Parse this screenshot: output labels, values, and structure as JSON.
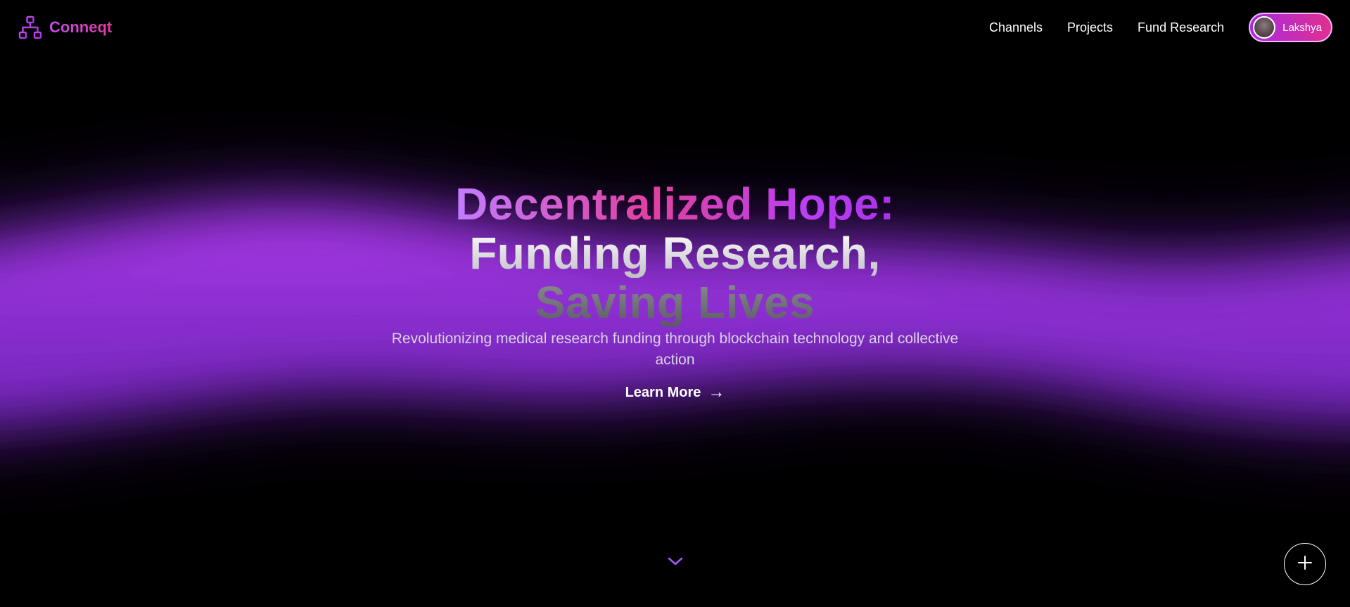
{
  "brand": {
    "name": "Conneqt",
    "icon": "network-hierarchy-icon"
  },
  "nav": {
    "links": [
      {
        "label": "Channels"
      },
      {
        "label": "Projects"
      },
      {
        "label": "Fund Research"
      }
    ],
    "user": {
      "name": "Lakshya",
      "avatar": "user-avatar"
    }
  },
  "hero": {
    "headline_line1": "Decentralized Hope:",
    "headline_line2": "Funding Research,",
    "headline_line3": "Saving Lives",
    "subtitle": "Revolutionizing medical research funding through blockchain technology and collective action",
    "cta_label": "Learn More",
    "cta_arrow": "→"
  },
  "scroll_indicator": {
    "icon": "chevron-down-icon"
  },
  "fab": {
    "icon": "plus-icon"
  },
  "colors": {
    "background": "#000000",
    "accent_purple": "#a832e8",
    "accent_pink": "#e02f8e",
    "glow": "#8a2fd0"
  }
}
